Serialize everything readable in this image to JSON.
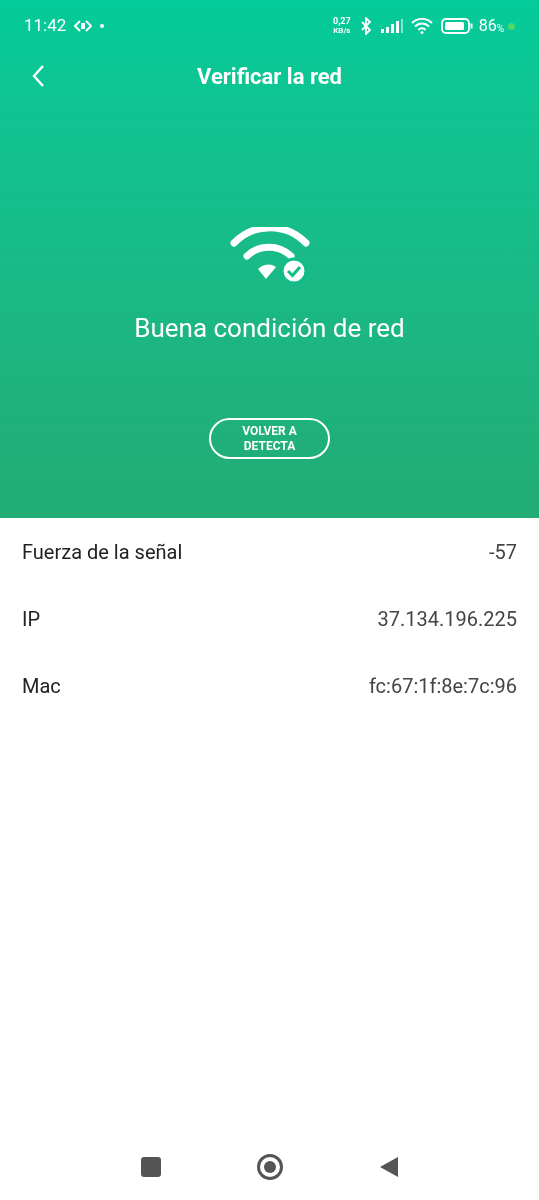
{
  "status_bar": {
    "time": "11:42",
    "speed_value": "0,27",
    "speed_unit": "KB/s",
    "battery_percent": "86",
    "percent_sign": "%"
  },
  "header": {
    "title": "Verificar la red"
  },
  "status": {
    "message": "Buena condición de red",
    "button": "VOLVER A DETECTA"
  },
  "details": [
    {
      "label": "Fuerza de la señal",
      "value": "-57"
    },
    {
      "label": "IP",
      "value": "37.134.196.225"
    },
    {
      "label": "Mac",
      "value": "fc:67:1f:8e:7c:96"
    }
  ]
}
